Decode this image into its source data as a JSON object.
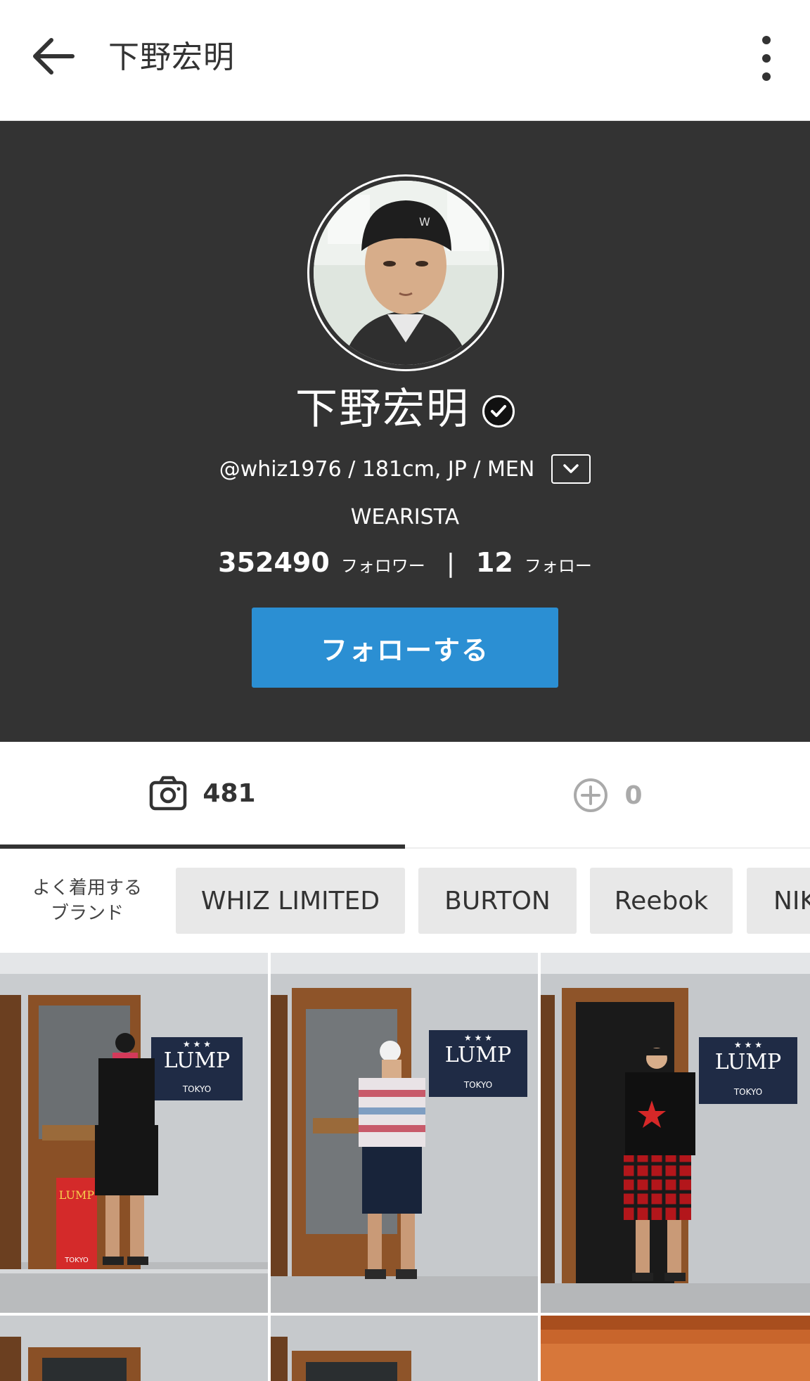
{
  "appbar": {
    "title": "下野宏明"
  },
  "profile": {
    "name": "下野宏明",
    "meta": "@whiz1976 / 181cm, JP / MEN",
    "role": "WEARISTA",
    "followers_count": "352490",
    "followers_label": "フォロワー",
    "separator": "|",
    "following_count": "12",
    "following_label": "フォロー",
    "follow_button": "フォローする"
  },
  "tabs": {
    "posts_count": "481",
    "other_count": "0"
  },
  "brands": {
    "label_line1": "よく着用する",
    "label_line2": "ブランド",
    "chips": [
      "WHIZ LIMITED",
      "BURTON",
      "Reebok",
      "NIK"
    ]
  },
  "grid": {
    "sign_text": "LUMP",
    "sign_subtext": "TOKYO",
    "poster_text": "LUMP",
    "poster_subtext": "TOKYO",
    "sign_stars": "★ ★ ★"
  },
  "colors": {
    "header_bg": "#333333",
    "accent": "#2b8fd3",
    "chip_bg": "#e8e8e8"
  },
  "icons": [
    "back-arrow-icon",
    "more-vert-icon",
    "verified-check-icon",
    "chevron-down-icon",
    "camera-icon",
    "add-circle-icon"
  ]
}
